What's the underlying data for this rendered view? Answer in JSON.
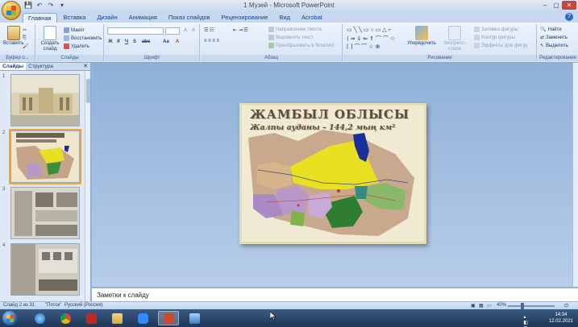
{
  "window": {
    "title": "1 Музей - Microsoft PowerPoint",
    "controls": [
      "‒",
      "▢",
      "✕"
    ]
  },
  "quick_access": [
    "save",
    "undo",
    "redo",
    "dropdown"
  ],
  "tabs": [
    {
      "label": "Главная",
      "active": true
    },
    {
      "label": "Вставка",
      "active": false
    },
    {
      "label": "Дизайн",
      "active": false
    },
    {
      "label": "Анимация",
      "active": false
    },
    {
      "label": "Показ слайдов",
      "active": false
    },
    {
      "label": "Рецензирование",
      "active": false
    },
    {
      "label": "Вид",
      "active": false
    },
    {
      "label": "Acrobat",
      "active": false
    }
  ],
  "ribbon": {
    "clipboard": {
      "label": "Буфер о...",
      "paste": "Вставить"
    },
    "slides": {
      "label": "Слайды",
      "create": "Создать слайд",
      "layout": "Макет",
      "reset": "Восстановить",
      "delete": "Удалить"
    },
    "font": {
      "label": "Шрифт",
      "bold": "Ж",
      "italic": "К",
      "underline": "Ч",
      "strike": "S",
      "abc": "abc",
      "size_up": "A",
      "size_down": "A",
      "case": "Aa"
    },
    "paragraph": {
      "label": "Абзац",
      "direction": "Направление текста",
      "align_text": "Выровнять текст",
      "smartart": "Преобразовать в SmartArt"
    },
    "drawing": {
      "label": "Рисование",
      "arrange": "Упорядочить",
      "quick_styles": "Экспресс-стили",
      "fill": "Заливка фигуры",
      "outline": "Контур фигуры",
      "effects": "Эффекты для фигур"
    },
    "editing": {
      "label": "Редактирование",
      "find": "Найти",
      "replace": "Заменить",
      "select": "Выделить"
    }
  },
  "panel": {
    "tab_slides": "Слайды",
    "tab_outline": "Структура",
    "close": "✕",
    "slide_numbers": [
      "1",
      "2",
      "3",
      "4"
    ],
    "selected_index": 2
  },
  "slide": {
    "title": "ЖАМБЫЛ ОБЛЫСЫ",
    "subtitle": "Жалпы ауданы – 144,2 мың км²"
  },
  "notes": {
    "placeholder": "Заметки к слайду"
  },
  "status": {
    "slide_info": "Слайд 2 из 31",
    "theme": "\"Поток\"",
    "language": "Русский (Россия)",
    "zoom": "40%"
  },
  "taskbar": {
    "apps": [
      "internet-explorer",
      "chrome",
      "acrobat",
      "file-explorer",
      "zoom",
      "powerpoint",
      "image-viewer"
    ],
    "active_app": "powerpoint"
  },
  "clock": {
    "time": "14:34",
    "date": "12.02.2021"
  },
  "colors": {
    "ribbon_accent": "#15428b",
    "selection": "#f3a53a",
    "map_yellow": "#e8e020",
    "map_green": "#3a8f3a",
    "map_blue": "#1a2f9a",
    "map_purple": "#b898c8"
  }
}
